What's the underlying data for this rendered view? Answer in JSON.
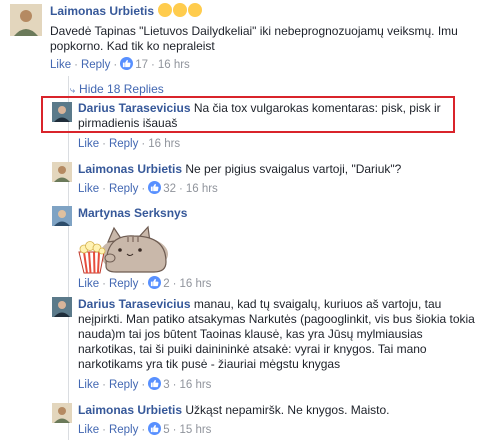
{
  "colors": {
    "link": "#4267b2",
    "name": "#365899",
    "meta": "#90949c",
    "like_badge": "#5890ff",
    "highlight_box": "#d9242b"
  },
  "comment1": {
    "author": "Laimonas Urbietis",
    "text": "Davedė Tapinas \"Lietuvos Dailydkeliai\" iki nebeprognozuojamų veiksmų. Imu popkorno. Kad tik ko nepraleist",
    "like": "Like",
    "reply": "Reply",
    "likes": "17",
    "time": "16 hrs",
    "emoji": "grinning-squinting-face-emoji"
  },
  "hide_replies": {
    "label": "Hide 18 Replies"
  },
  "reply1": {
    "author": "Darius Tarasevicius",
    "text": "Na čia tox vulgarokas komentaras: pisk, pisk ir pirmadienis išauaš",
    "like": "Like",
    "reply": "Reply",
    "time": "16 hrs"
  },
  "reply2": {
    "author": "Laimonas Urbietis",
    "text": "Ne per pigius svaigalus vartoji, \"Dariuk\"?",
    "like": "Like",
    "reply": "Reply",
    "likes": "32",
    "time": "16 hrs"
  },
  "reply3": {
    "author": "Martynas Serksnys",
    "sticker": "pusheen-cat-popcorn-sticker",
    "like": "Like",
    "reply": "Reply",
    "likes": "2",
    "time": "16 hrs"
  },
  "reply4": {
    "author": "Darius Tarasevicius",
    "text": "manau, kad tų svaigalų, kuriuos aš vartoju, tau neįpirkti. Man patiko atsakymas Narkutės (pagooglinkit, vis bus šiokia tokia nauda)m tai jos būtent Taoinas klausė, kas yra Jūsų mylmiausias narkotikas, tai ši puiki dainininkė atsakė: vyrai ir knygos. Tai mano narkotikams yra tik pusė - žiauriai mėgstu knygas",
    "like": "Like",
    "reply": "Reply",
    "likes": "3",
    "time": "16 hrs"
  },
  "reply5": {
    "author": "Laimonas Urbietis",
    "text": "Užkąst nepamiršk. Ne knygos. Maisto.",
    "like": "Like",
    "reply": "Reply",
    "likes": "5",
    "time": "15 hrs"
  }
}
